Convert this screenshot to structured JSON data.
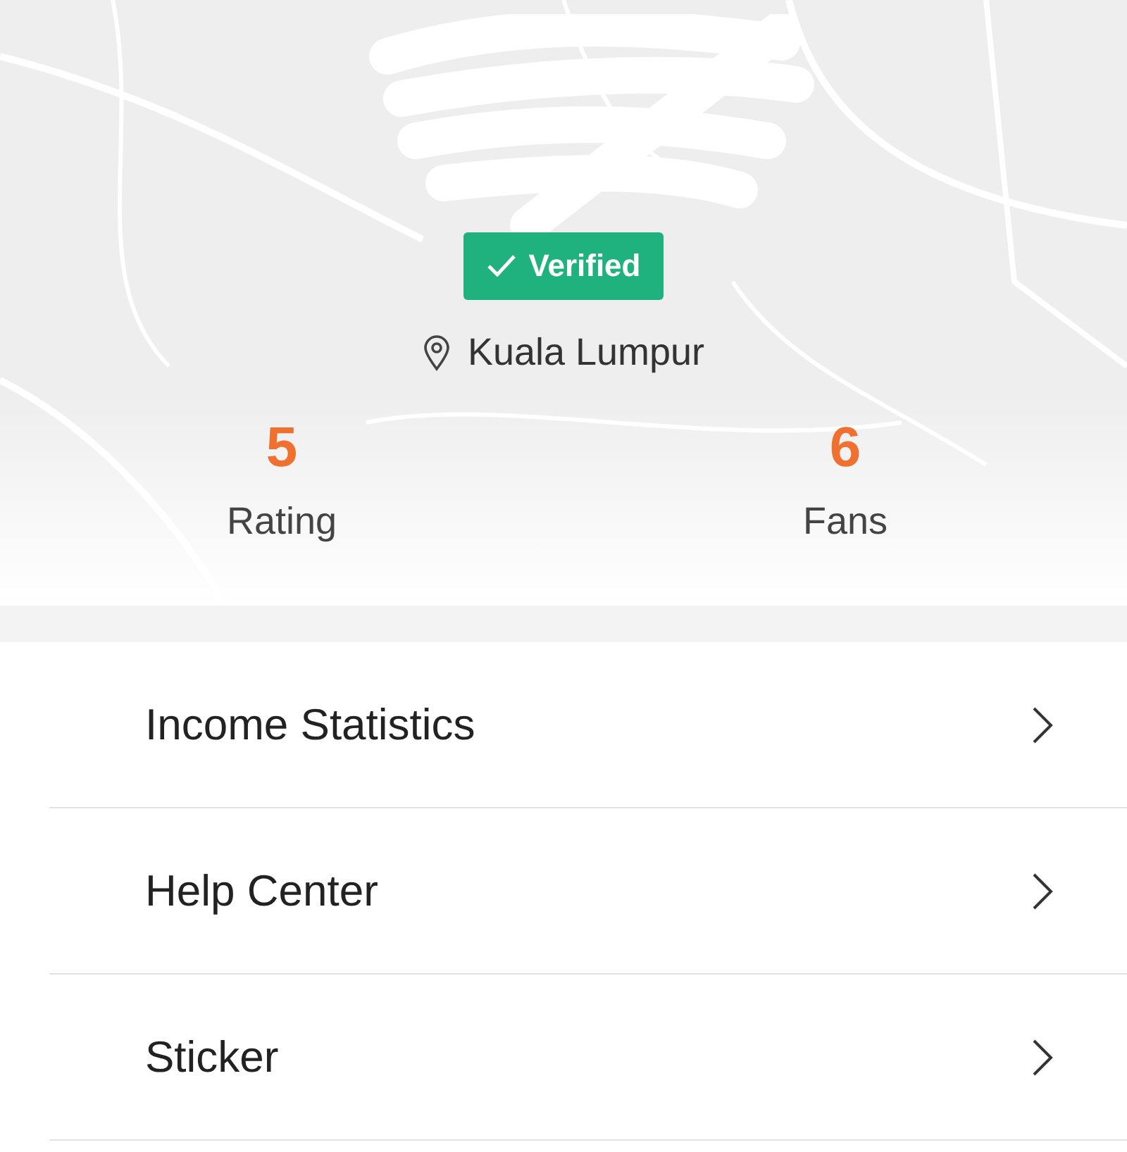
{
  "profile": {
    "badge": "Verified",
    "location": "Kuala Lumpur"
  },
  "stats": [
    {
      "value": "5",
      "label": "Rating"
    },
    {
      "value": "6",
      "label": "Fans"
    }
  ],
  "menu": [
    {
      "label": "Income Statistics"
    },
    {
      "label": "Help Center"
    },
    {
      "label": "Sticker"
    }
  ]
}
